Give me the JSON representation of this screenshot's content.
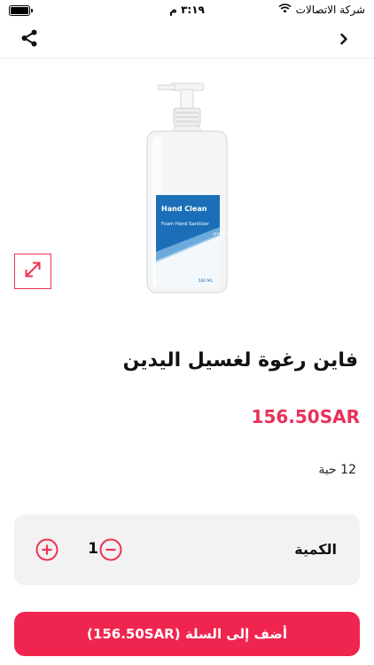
{
  "status_bar": {
    "carrier": "شركة الاتصالات",
    "time": "٣:١٩ م",
    "battery_level": 1.0
  },
  "nav": {
    "back_icon": "chevron-right-icon",
    "share_icon": "share-icon"
  },
  "product": {
    "title": "فاين رغوة لغسيل اليدين",
    "price": "156.50SAR",
    "unit": "12 حبة",
    "image": {
      "brand_text": "Hand Clean",
      "product_text": "Foam Hand Sanitizer",
      "arabic_text": "رغوة لتعقيم الأيدي",
      "volume_text": "500 ML"
    }
  },
  "quantity": {
    "label": "الكمية",
    "value": "1"
  },
  "cart": {
    "button_label": "أضف إلى السلة (156.50SAR)"
  },
  "colors": {
    "accent": "#f0254f",
    "price": "#e8315a",
    "card_bg": "#f2f2f4"
  }
}
